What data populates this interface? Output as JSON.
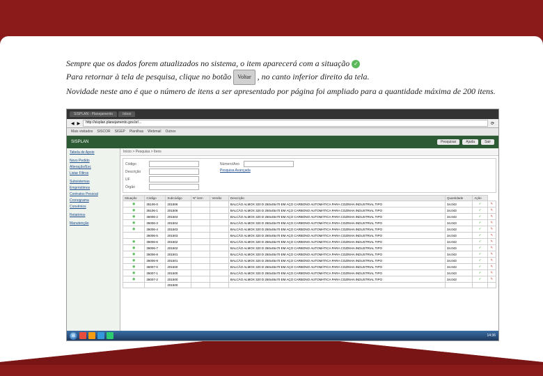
{
  "para": {
    "l1a": "Sempre que os dados forem atualizados no sistema, o item aparecerá com a situação ",
    "l2a": "Para retornar à tela de pesquisa, clique no botão ",
    "voltar": "Voltar",
    "l2b": " , no canto inferior direito da tela.",
    "l3": "Novidade neste ano é que o número de itens a ser apresentado por página foi ampliado para a quantidade máxima de 200 itens."
  },
  "browser": {
    "tabs": [
      "SISPLAN - Planejamento",
      "Inbox"
    ],
    "url": "http://sisplan.planejamento.gov.br/...",
    "bookmarks": [
      "Mais visitados",
      "SISCOR",
      "SIGEP",
      "Planilhas",
      "Webmail",
      "Outros"
    ]
  },
  "app": {
    "title": "SISPLAN",
    "btns": [
      "Pesquisar",
      "Ajuda",
      "Sair"
    ]
  },
  "sidebar": [
    "Tabela de Apoio",
    "",
    "Novo Pedido",
    "Alteração/Exc",
    "Listar Filtros",
    "",
    "Subsistemas",
    "Empréstimos",
    "Contratos Pessoal",
    "Cronograma",
    "Convênios",
    "",
    "Relatórios",
    "",
    "Manutenção"
  ],
  "crumb": "Início > Pesquisa > Itens",
  "filters": {
    "lbls": [
      "Código",
      "Descrição",
      "UF",
      "Órgão",
      "Número/Ano"
    ],
    "sec": "Pesquisa Avançada"
  },
  "cols": [
    "Situação",
    "Código",
    "Subcódigo",
    "Nº item",
    "Versão",
    "Descrição",
    "Quantidade",
    "Ação"
  ],
  "rows": [
    [
      "◉",
      "35106-0",
      "201506",
      "",
      "",
      "BALCÃO ALMOX 320 D 250x45x70 EM AÇO CARBONO AUTOMÁTICA PARA COZINHA INDUSTRIAL TIPO",
      "34.043",
      "✓",
      "✎"
    ],
    [
      "◉",
      "35106-1",
      "201506",
      "",
      "",
      "BALCÃO ALMOX 320 D 250x45x70 EM AÇO CARBONO AUTOMÁTICA PARA COZINHA INDUSTRIAL TIPO",
      "34.043",
      "✓",
      "✎"
    ],
    [
      "◉",
      "35006-2",
      "201504",
      "",
      "",
      "BALCÃO ALMOX 320 D 250x45x70 EM AÇO CARBONO AUTOMÁTICA PARA COZINHA INDUSTRIAL TIPO",
      "34.043",
      "✓",
      "✎"
    ],
    [
      "◉",
      "35006-3",
      "201504",
      "",
      "",
      "BALCÃO ALMOX 320 D 250x45x70 EM AÇO CARBONO AUTOMÁTICA PARA COZINHA INDUSTRIAL TIPO",
      "34.043",
      "✓",
      "✎"
    ],
    [
      "◉",
      "35006-4",
      "201503",
      "",
      "",
      "BALCÃO ALMOX 320 D 250x45x70 EM AÇO CARBONO AUTOMÁTICA PARA COZINHA INDUSTRIAL TIPO",
      "34.043",
      "✓",
      "✎"
    ],
    [
      "",
      "35006-5",
      "201503",
      "",
      "",
      "BALCÃO ALMOX 320 D 250x45x70 EM AÇO CARBONO AUTOMÁTICA PARA COZINHA INDUSTRIAL TIPO",
      "34.043",
      "✓",
      "✎"
    ],
    [
      "◉",
      "35006-6",
      "201502",
      "",
      "",
      "BALCÃO ALMOX 320 D 250x45x70 EM AÇO CARBONO AUTOMÁTICA PARA COZINHA INDUSTRIAL TIPO",
      "34.043",
      "✓",
      "✎"
    ],
    [
      "◉",
      "35006-7",
      "201502",
      "",
      "",
      "BALCÃO ALMOX 320 D 250x45x70 EM AÇO CARBONO AUTOMÁTICA PARA COZINHA INDUSTRIAL TIPO",
      "34.043",
      "✓",
      "✎"
    ],
    [
      "◉",
      "35006-8",
      "201501",
      "",
      "",
      "BALCÃO ALMOX 320 D 250x45x70 EM AÇO CARBONO AUTOMÁTICA PARA COZINHA INDUSTRIAL TIPO",
      "34.043",
      "✓",
      "✎"
    ],
    [
      "◉",
      "35006-9",
      "201501",
      "",
      "",
      "BALCÃO ALMOX 320 D 250x45x70 EM AÇO CARBONO AUTOMÁTICA PARA COZINHA INDUSTRIAL TIPO",
      "34.043",
      "✓",
      "✎"
    ],
    [
      "◉",
      "35007-0",
      "201500",
      "",
      "",
      "BALCÃO ALMOX 320 D 250x45x70 EM AÇO CARBONO AUTOMÁTICA PARA COZINHA INDUSTRIAL TIPO",
      "34.043",
      "✓",
      "✎"
    ],
    [
      "◉",
      "35007-1",
      "201500",
      "",
      "",
      "BALCÃO ALMOX 320 D 250x45x70 EM AÇO CARBONO AUTOMÁTICA PARA COZINHA INDUSTRIAL TIPO",
      "34.043",
      "✓",
      "✎"
    ],
    [
      "◉",
      "35007-2",
      "201500",
      "",
      "",
      "BALCÃO ALMOX 320 D 250x45x70 EM AÇO CARBONO AUTOMÁTICA PARA COZINHA INDUSTRIAL TIPO",
      "34.043",
      "✓",
      "✎"
    ],
    [
      "",
      "",
      "201500",
      "",
      "",
      "",
      "",
      "",
      ""
    ]
  ],
  "taskbar": {
    "time": "14:36"
  }
}
